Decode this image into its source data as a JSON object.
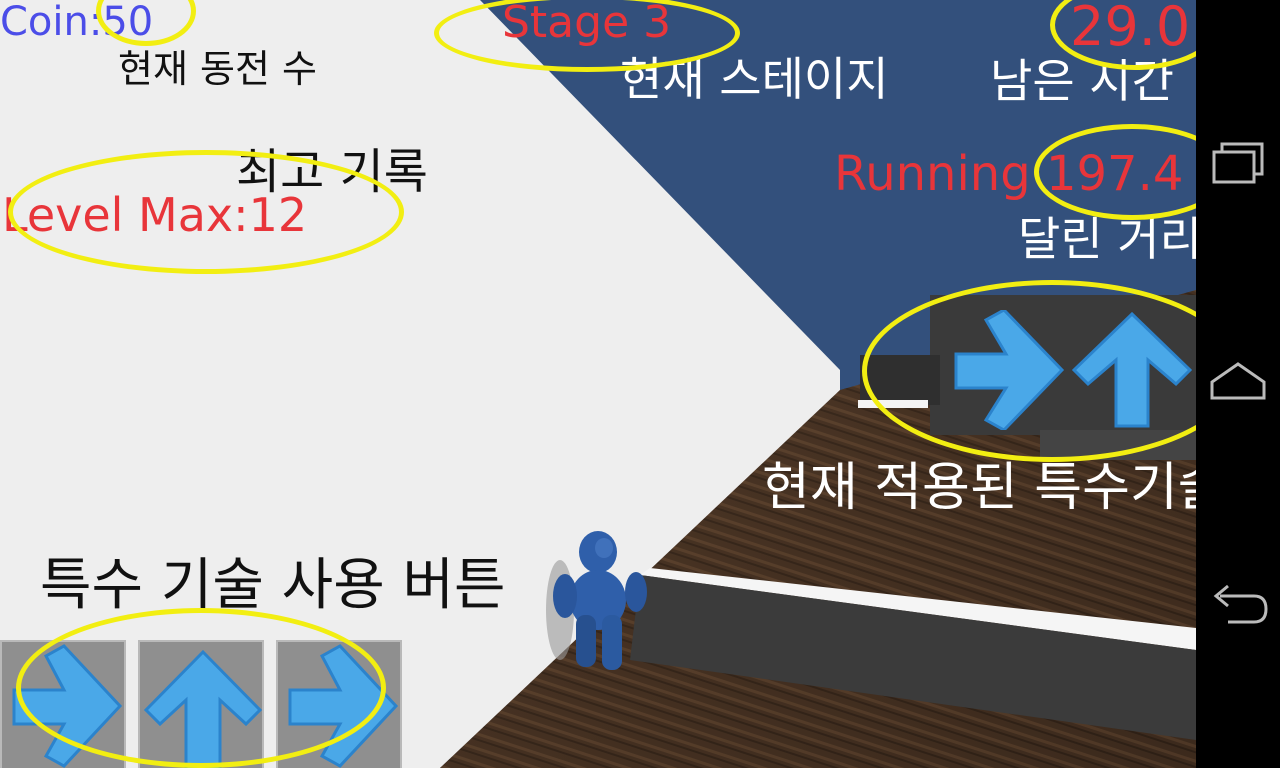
{
  "hud": {
    "coin": "Coin:50",
    "stage": "Stage 3",
    "timer": "29.0",
    "level_max": "Level Max:12",
    "running": "Running 197.4"
  },
  "annotations": {
    "coin_label": "현재 동전 수",
    "stage_label": "현재 스테이지",
    "time_label": "남은 시간",
    "best_label": "최고 기록",
    "distance_label": "달린 거리",
    "active_skill_label": "현재 적용된 특수기술",
    "skill_button_label": "특수 기술 사용 버튼"
  },
  "active_skills": [
    "arrow-right-icon",
    "arrow-up-icon"
  ],
  "skill_buttons": [
    "arrow-right-icon",
    "arrow-up-icon",
    "arrow-right-icon"
  ],
  "navbar": [
    "recent-apps-icon",
    "home-icon",
    "back-icon"
  ],
  "colors": {
    "hud_red": "#e8353a",
    "hud_blue": "#4b4de8",
    "highlight": "#f2ee12",
    "sky": "#33507c",
    "wall": "#eeeeee",
    "arrow": "#4aa8e8"
  }
}
